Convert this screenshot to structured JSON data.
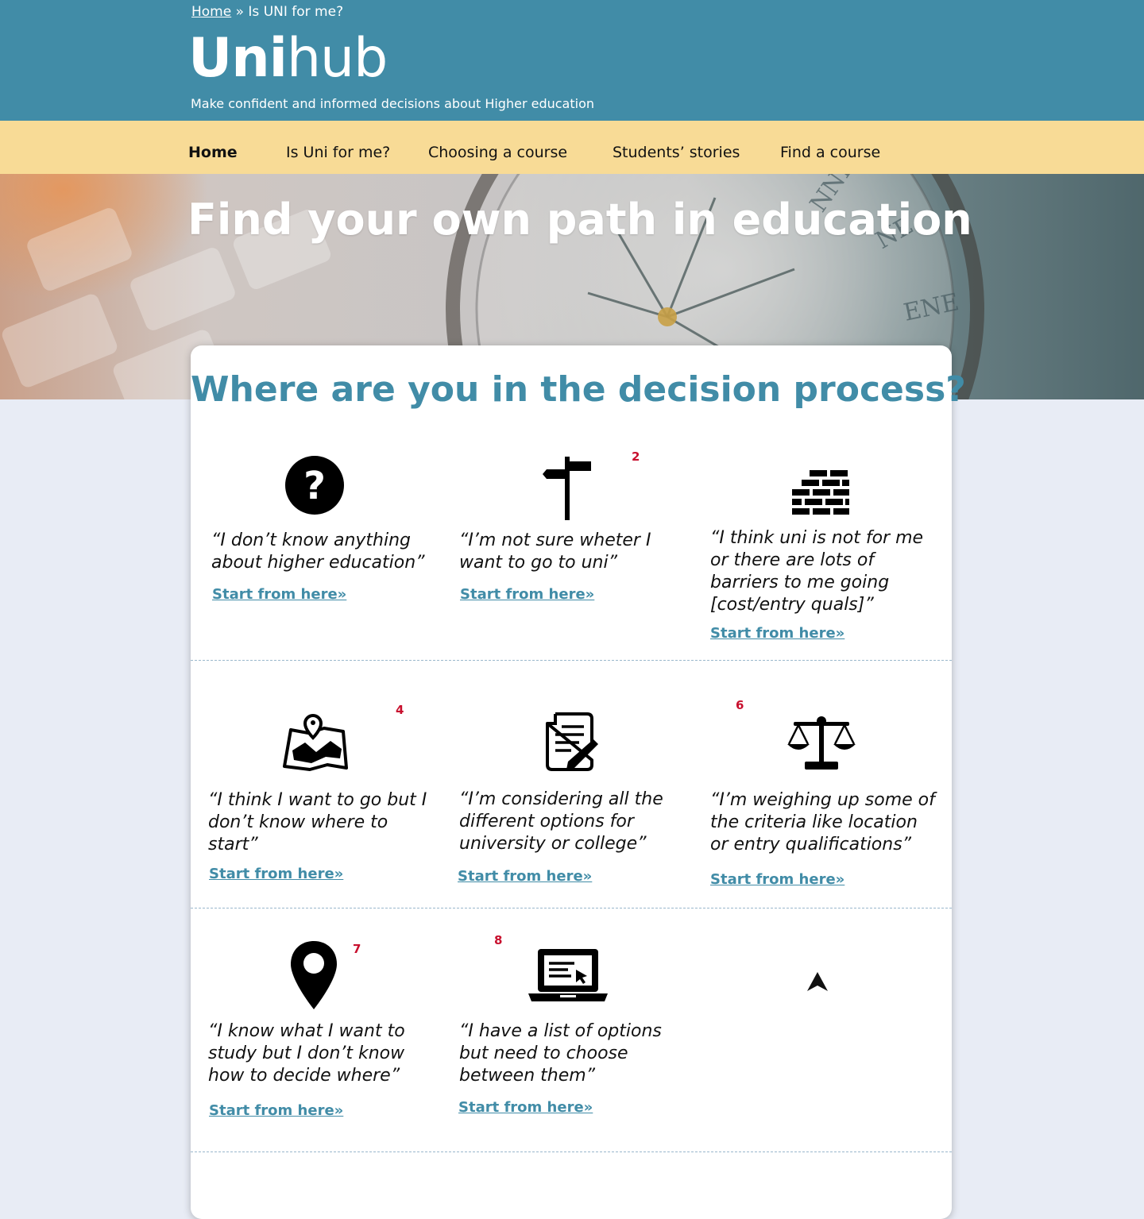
{
  "breadcrumb": {
    "home": "Home",
    "separator": " » ",
    "current": "Is UNI for me?"
  },
  "logo": {
    "bold": "Uni",
    "light": "hub"
  },
  "tagline": "Make confident and informed decisions about Higher education",
  "nav": {
    "items": [
      "Home",
      "Is Uni for me?",
      "Choosing a course",
      "Students’ stories",
      "Find a course"
    ],
    "active": "Home"
  },
  "hero": {
    "title": "Find your own path in education"
  },
  "decision": {
    "title": "Where are you in the decision process?",
    "options": [
      {
        "icon": "question-icon",
        "quote": "“I don’t know anything about higher education”",
        "link": "Start from here»"
      },
      {
        "icon": "signpost-icon",
        "marker": "2",
        "quote": "“I’m not sure wheter I want to go to uni”",
        "link": "Start from here»"
      },
      {
        "icon": "brick-wall-icon",
        "quote": "“I think uni is not for me or there are lots of barriers to me going [cost/entry quals]”",
        "link": "Start from here»"
      },
      {
        "icon": "map-icon",
        "marker": "4",
        "quote": "“I think I want to go but I don’t know where to start”",
        "link": "Start from here»"
      },
      {
        "icon": "document-edit-icon",
        "quote": "“I’m considering all the different options for university or college”",
        "link": "Start from here»"
      },
      {
        "icon": "scales-icon",
        "marker": "6",
        "quote": "“I’m weighing up some of the criteria like location or entry qualifications”",
        "link": "Start from here»"
      },
      {
        "icon": "location-pin-icon",
        "marker": "7",
        "quote": "“I know what I want to study but I don’t know how to decide where”",
        "link": "Start from here»"
      },
      {
        "icon": "laptop-icon",
        "marker": "8",
        "quote": "“I have a list of options but need to choose between them”",
        "link": "Start from here»"
      }
    ]
  },
  "cursor_icon": "mouse-pointer-icon",
  "colors": {
    "header": "#418ca7",
    "nav": "#f8db96",
    "link": "#418ca7",
    "marker": "#c8102e",
    "page": "#e8ecf5"
  }
}
